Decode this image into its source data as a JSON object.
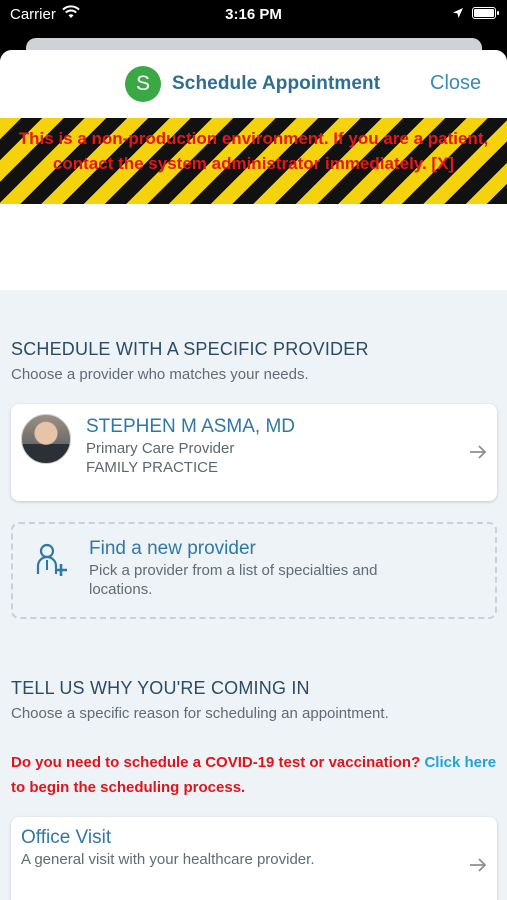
{
  "status_bar": {
    "carrier": "Carrier",
    "time": "3:16 PM"
  },
  "nav": {
    "avatar_letter": "S",
    "title": "Schedule Appointment",
    "close_label": "Close",
    "accent": "#3aa845"
  },
  "warning": {
    "text": "This is a non-production environment. If you are a patient, contact the system administrator immediately. [X]"
  },
  "specific_provider": {
    "title": "SCHEDULE WITH A SPECIFIC PROVIDER",
    "subtitle": "Choose a provider who matches your needs.",
    "provider": {
      "name": "STEPHEN M ASMA, MD",
      "role": "Primary Care Provider",
      "specialty": "FAMILY PRACTICE"
    }
  },
  "find_provider": {
    "title": "Find a new provider",
    "subtitle": "Pick a provider from a list of specialties and locations.",
    "icon": "person-add-icon"
  },
  "reason": {
    "title": "TELL US WHY YOU'RE COMING IN",
    "subtitle": "Choose a specific reason for scheduling an appointment."
  },
  "covid": {
    "prefix": "Do you need to schedule a COVID-19 test or vaccination? ",
    "link": "Click here",
    "suffix": " to begin the scheduling process."
  },
  "office_visit": {
    "title": "Office Visit",
    "subtitle": "A general visit with your healthcare provider."
  }
}
